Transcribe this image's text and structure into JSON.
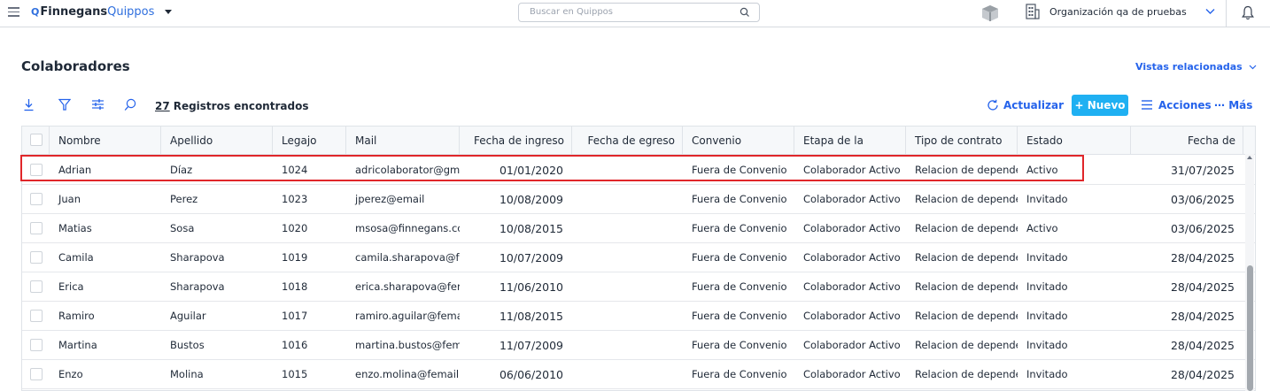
{
  "topbar": {
    "logo_brand": "Finnegans",
    "logo_product": "Quippos",
    "search_placeholder": "Buscar en Quippos",
    "organization": "Organización qa de pruebas"
  },
  "page": {
    "title": "Colaboradores",
    "related_views": "Vistas relacionadas"
  },
  "toolbar": {
    "records_count": "27",
    "records_label": "Registros encontrados",
    "refresh_label": "Actualizar",
    "new_label": "+ Nuevo",
    "actions_label": "Acciones",
    "more_label": "Más"
  },
  "table": {
    "columns": [
      "Nombre",
      "Apellido",
      "Legajo",
      "Mail",
      "Fecha de ingreso",
      "Fecha de egreso",
      "Convenio",
      "Etapa de la",
      "Tipo de contrato",
      "Estado",
      "Fecha de"
    ],
    "rows": [
      {
        "nombre": "Adrian",
        "apellido": "Díaz",
        "legajo": "1024",
        "mail": "adricolaborator@gmail.com",
        "ingreso": "01/01/2020",
        "egreso": "",
        "convenio": "Fuera de Convenio",
        "etapa": "Colaborador Activo",
        "contrato": "Relacion de dependencia",
        "estado": "Activo",
        "fecha": "31/07/2025"
      },
      {
        "nombre": "Juan",
        "apellido": "Perez",
        "legajo": "1023",
        "mail": "jperez@email",
        "ingreso": "10/08/2009",
        "egreso": "",
        "convenio": "Fuera de Convenio",
        "etapa": "Colaborador Activo",
        "contrato": "Relacion de dependencia",
        "estado": "Invitado",
        "fecha": "03/06/2025"
      },
      {
        "nombre": "Matias",
        "apellido": "Sosa",
        "legajo": "1020",
        "mail": "msosa@finnegans.com",
        "ingreso": "10/08/2015",
        "egreso": "",
        "convenio": "Fuera de Convenio",
        "etapa": "Colaborador Activo",
        "contrato": "Relacion de dependencia",
        "estado": "Activo",
        "fecha": "03/06/2025"
      },
      {
        "nombre": "Camila",
        "apellido": "Sharapova",
        "legajo": "1019",
        "mail": "camila.sharapova@femail.com",
        "ingreso": "10/07/2009",
        "egreso": "",
        "convenio": "Fuera de Convenio",
        "etapa": "Colaborador Activo",
        "contrato": "Relacion de dependencia",
        "estado": "Invitado",
        "fecha": "28/04/2025"
      },
      {
        "nombre": "Erica",
        "apellido": "Sharapova",
        "legajo": "1018",
        "mail": "erica.sharapova@femail.com",
        "ingreso": "11/06/2010",
        "egreso": "",
        "convenio": "Fuera de Convenio",
        "etapa": "Colaborador Activo",
        "contrato": "Relacion de dependencia",
        "estado": "Invitado",
        "fecha": "28/04/2025"
      },
      {
        "nombre": "Ramiro",
        "apellido": "Aguilar",
        "legajo": "1017",
        "mail": "ramiro.aguilar@femail.com",
        "ingreso": "11/08/2015",
        "egreso": "",
        "convenio": "Fuera de Convenio",
        "etapa": "Colaborador Activo",
        "contrato": "Relacion de dependencia",
        "estado": "Invitado",
        "fecha": "28/04/2025"
      },
      {
        "nombre": "Martina",
        "apellido": "Bustos",
        "legajo": "1016",
        "mail": "martina.bustos@femail.com",
        "ingreso": "11/07/2009",
        "egreso": "",
        "convenio": "Fuera de Convenio",
        "etapa": "Colaborador Activo",
        "contrato": "Relacion de dependencia",
        "estado": "Invitado",
        "fecha": "28/04/2025"
      },
      {
        "nombre": "Enzo",
        "apellido": "Molina",
        "legajo": "1015",
        "mail": "enzo.molina@femail.com",
        "ingreso": "06/06/2010",
        "egreso": "",
        "convenio": "Fuera de Convenio",
        "etapa": "Colaborador Activo",
        "contrato": "Relacion de dependencia",
        "estado": "Invitado",
        "fecha": "28/04/2025"
      }
    ]
  },
  "colors": {
    "accent": "#2563eb",
    "new_button": "#1fb0f2",
    "highlight": "#e0262a"
  },
  "icons": [
    "menu-icon",
    "search-icon",
    "cube-icon",
    "building-icon",
    "chevron-down-icon",
    "bell-icon",
    "download-icon",
    "filter-icon",
    "sliders-icon",
    "refresh-icon",
    "list-icon",
    "ellipsis-icon"
  ]
}
